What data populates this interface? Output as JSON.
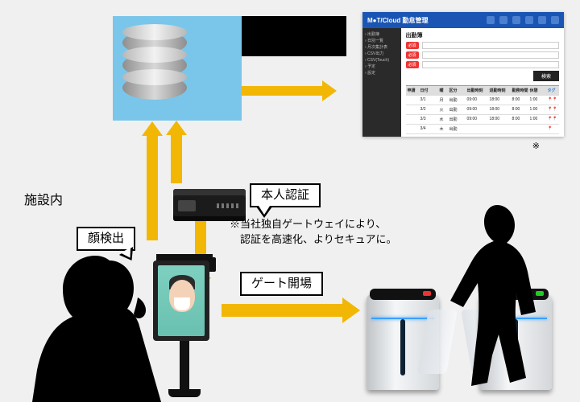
{
  "section_label": "施設内",
  "labels": {
    "face_detect": "顔検出",
    "auth": "本人認証",
    "gate_open": "ゲート開場"
  },
  "note": "※当社独自ゲートウェイにより、\n　認証を高速化、よりセキュアに。",
  "caption_right": "※",
  "app": {
    "brand": "M●T/Cloud 勤怠管理",
    "title": "出勤簿",
    "required": "必須",
    "search_btn": "検索",
    "side": [
      "出勤簿",
      "日別一覧",
      "月次集計表",
      "CSV出力",
      "CSV(Touch)",
      "予定",
      "設定"
    ],
    "headers": [
      "申請",
      "日付",
      "曜",
      "区分",
      "出勤時刻",
      "退勤時刻",
      "勤務時間",
      "休憩",
      "タグ"
    ],
    "rows": [
      [
        "",
        "3/1",
        "月",
        "出勤",
        "09:00",
        "18:00",
        "8:00",
        "1:00",
        "📍📍"
      ],
      [
        "",
        "3/2",
        "火",
        "出勤",
        "09:00",
        "18:00",
        "8:00",
        "1:00",
        "📍📍"
      ],
      [
        "",
        "3/3",
        "水",
        "出勤",
        "09:00",
        "18:00",
        "8:00",
        "1:00",
        "📍📍"
      ],
      [
        "",
        "3/4",
        "木",
        "出勤",
        "",
        "",
        "",
        "",
        "📍"
      ]
    ]
  }
}
